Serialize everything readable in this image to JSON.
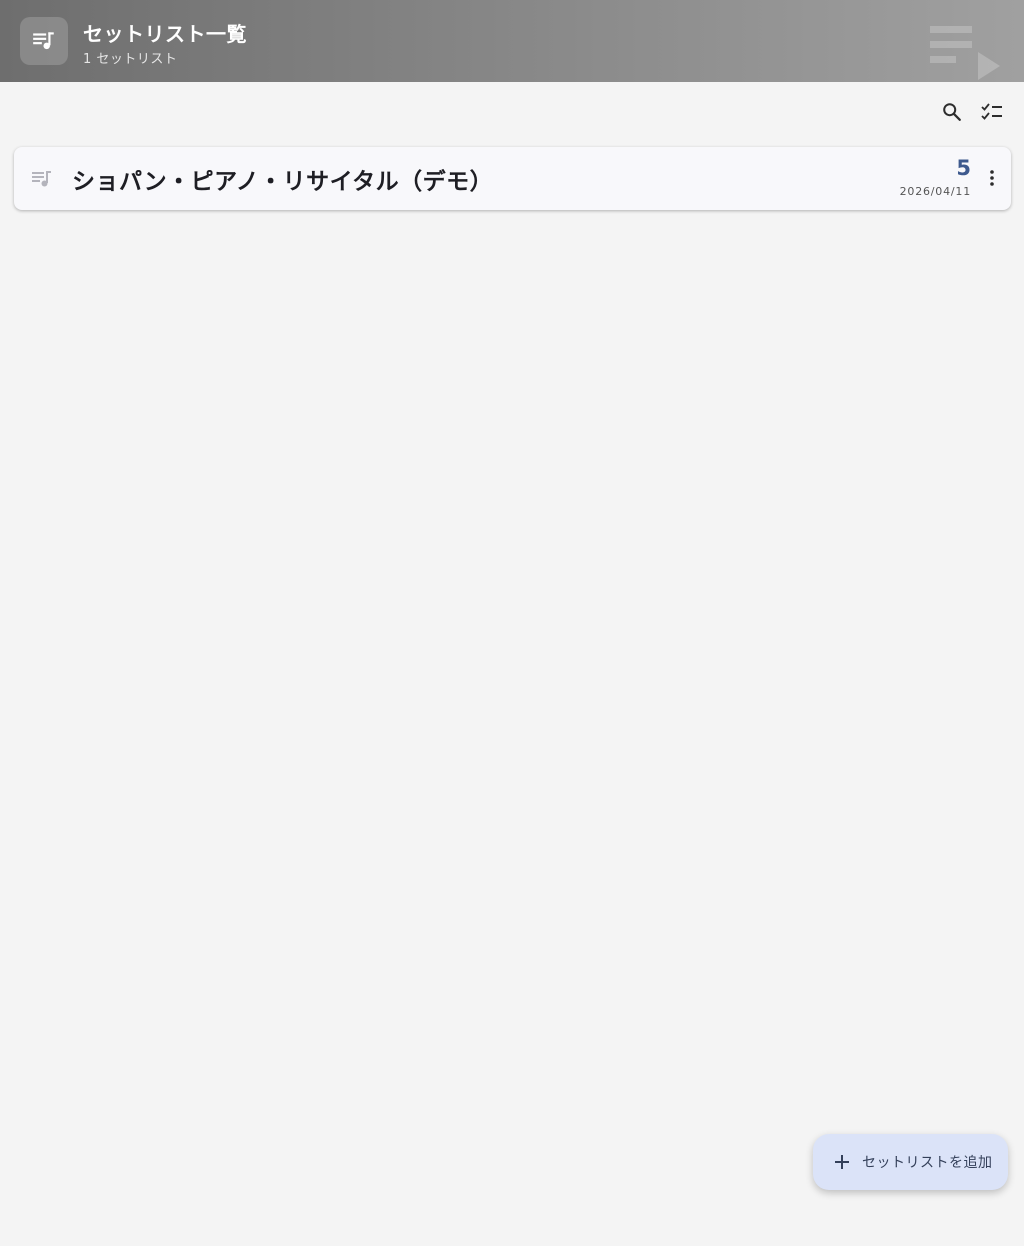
{
  "header": {
    "title": "セットリスト一覧",
    "subtitle": "1 セットリスト",
    "icon": "queue-music-icon",
    "watermark_icon": "playlist-play-icon"
  },
  "toolbar": {
    "search_icon": "search-icon",
    "select_icon": "checklist-icon"
  },
  "setlists": [
    {
      "title": "ショパン・ピアノ・リサイタル（デモ）",
      "count": "5",
      "date": "2026/04/11",
      "icon": "queue-music-icon"
    }
  ],
  "fab": {
    "label": "セットリストを追加",
    "icon": "plus-icon"
  },
  "colors": {
    "accent": "#3e5a8e",
    "fab_background": "#dbe3f8",
    "page_background": "#f4f4f4"
  }
}
